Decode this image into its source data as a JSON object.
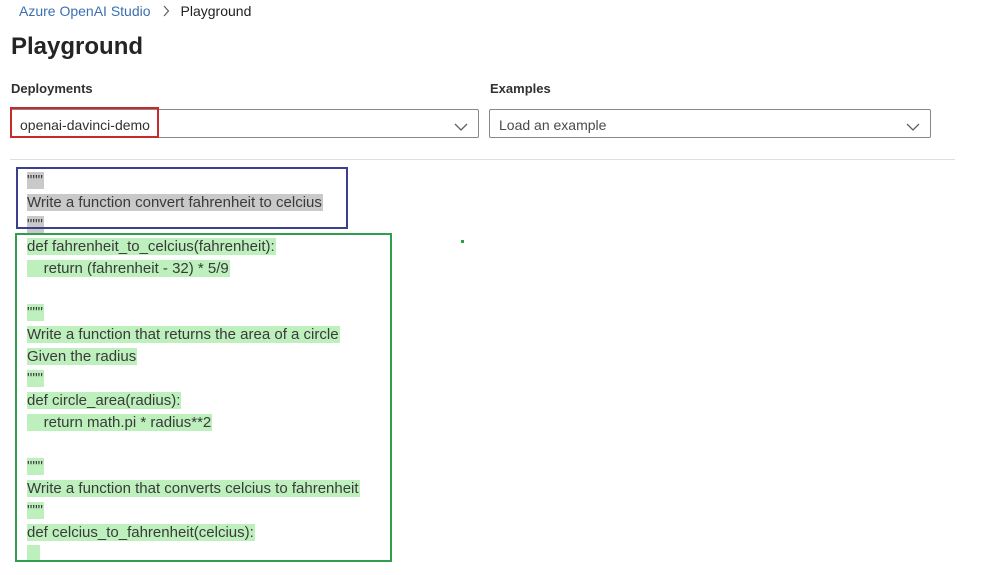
{
  "breadcrumb": {
    "root": "Azure OpenAI Studio",
    "current": "Playground"
  },
  "page": {
    "title": "Playground"
  },
  "deployments": {
    "label": "Deployments",
    "selected": "openai-davinci-demo"
  },
  "examples": {
    "label": "Examples",
    "placeholder": "Load an example"
  },
  "editor": {
    "prompt_lines": [
      "\"\"\"",
      "Write a function convert fahrenheit to celcius",
      "\"\"\""
    ],
    "completion_lines": [
      "def fahrenheit_to_celcius(fahrenheit):",
      "    return (fahrenheit - 32) * 5/9",
      "",
      "\"\"\"",
      "Write a function that returns the area of a circle",
      "Given the radius",
      "\"\"\"",
      "def circle_area(radius):",
      "    return math.pi * radius**2",
      "",
      "\"\"\"",
      "Write a function that converts celcius to fahrenheit",
      "\"\"\"",
      "def celcius_to_fahrenheit(celcius):"
    ]
  },
  "icons": {
    "breadcrumb_separator": "chevron-right-icon",
    "dropdown": "chevron-down-icon"
  },
  "colors": {
    "prompt_highlight": "#c9c9c9",
    "completion_highlight": "#bdf0bd",
    "deployment_annotation": "#c72a2a",
    "prompt_annotation": "#3c3e8e",
    "completion_annotation": "#2f9e4f"
  }
}
